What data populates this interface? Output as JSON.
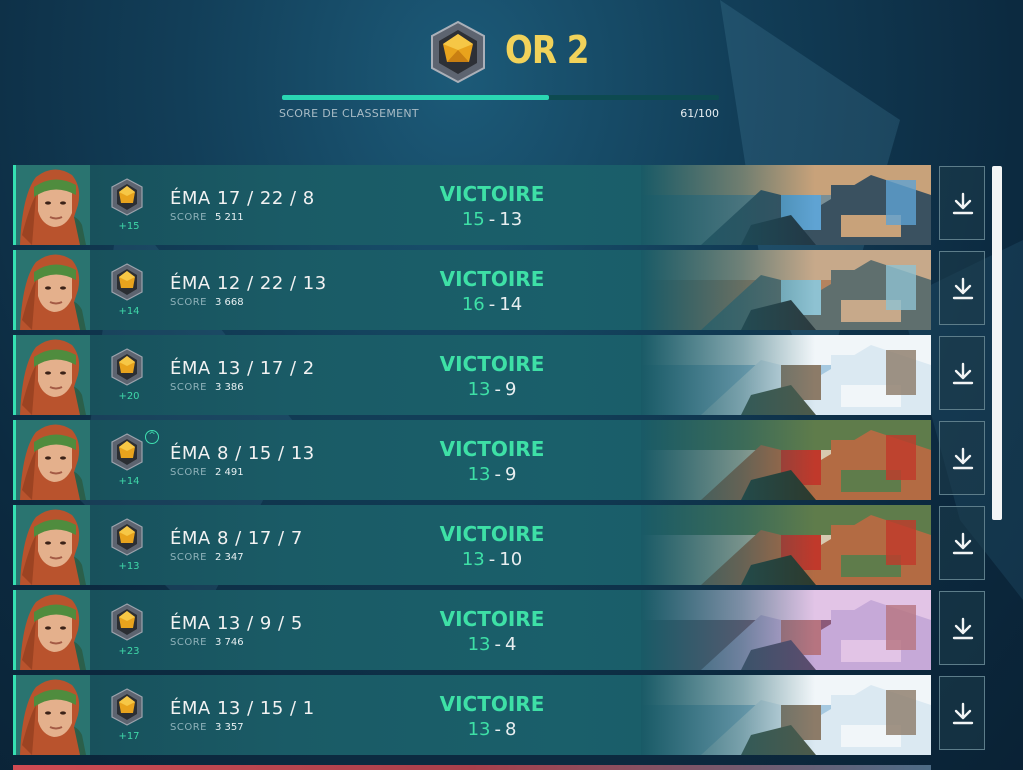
{
  "header": {
    "rank_name": "OR 2",
    "rank_icon": "gold-rank-icon",
    "progress_label": "SCORE DE CLASSEMENT",
    "progress_value_text": "61/100",
    "progress_fraction": 0.61,
    "accent_color": "#2ad6b3",
    "rank_color": "#f1d25a"
  },
  "matches": [
    {
      "agent": "ÉMA",
      "kda": "17 / 22 / 8",
      "score_label": "SCORE",
      "score": "5 211",
      "rr_change": "+15",
      "rank_up": false,
      "result": "VICTOIRE",
      "team_score": "15",
      "enemy_score": "13",
      "map": "map-1"
    },
    {
      "agent": "ÉMA",
      "kda": "12 / 22 / 13",
      "score_label": "SCORE",
      "score": "3 668",
      "rr_change": "+14",
      "rank_up": false,
      "result": "VICTOIRE",
      "team_score": "16",
      "enemy_score": "14",
      "map": "map-2"
    },
    {
      "agent": "ÉMA",
      "kda": "13 / 17 / 2",
      "score_label": "SCORE",
      "score": "3 386",
      "rr_change": "+20",
      "rank_up": false,
      "result": "VICTOIRE",
      "team_score": "13",
      "enemy_score": "9",
      "map": "map-3"
    },
    {
      "agent": "ÉMA",
      "kda": "8 / 15 / 13",
      "score_label": "SCORE",
      "score": "2 491",
      "rr_change": "+14",
      "rank_up": true,
      "result": "VICTOIRE",
      "team_score": "13",
      "enemy_score": "9",
      "map": "map-4"
    },
    {
      "agent": "ÉMA",
      "kda": "8 / 17 / 7",
      "score_label": "SCORE",
      "score": "2 347",
      "rr_change": "+13",
      "rank_up": false,
      "result": "VICTOIRE",
      "team_score": "13",
      "enemy_score": "10",
      "map": "map-4"
    },
    {
      "agent": "ÉMA",
      "kda": "13 / 9 / 5",
      "score_label": "SCORE",
      "score": "3 746",
      "rr_change": "+23",
      "rank_up": false,
      "result": "VICTOIRE",
      "team_score": "13",
      "enemy_score": "4",
      "map": "map-5"
    },
    {
      "agent": "ÉMA",
      "kda": "13 / 15 / 1",
      "score_label": "SCORE",
      "score": "3 357",
      "rr_change": "+17",
      "rank_up": false,
      "result": "VICTOIRE",
      "team_score": "13",
      "enemy_score": "8",
      "map": "map-3"
    }
  ],
  "icons": {
    "download": "download-icon",
    "rank_up": "chevron-up-icon",
    "agent_portrait": "agent-portrait"
  }
}
